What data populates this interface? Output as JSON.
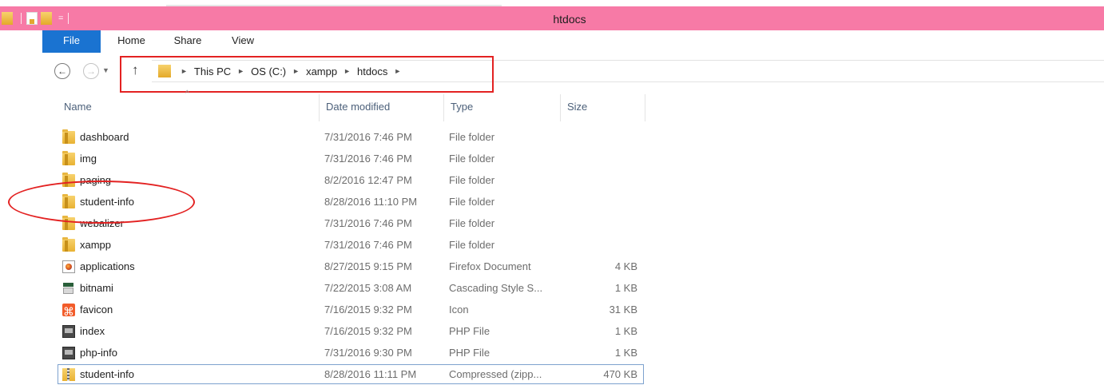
{
  "window": {
    "title": "htdocs",
    "accent_color": "#f77aa6"
  },
  "quick_access": {
    "icons": [
      "folder-icon",
      "properties-icon",
      "new-folder-icon"
    ],
    "dropdown_glyph": "="
  },
  "ribbon": {
    "tabs": [
      {
        "id": "file",
        "label": "File"
      },
      {
        "id": "home",
        "label": "Home"
      },
      {
        "id": "share",
        "label": "Share"
      },
      {
        "id": "view",
        "label": "View"
      }
    ]
  },
  "navigation": {
    "back_icon": "back-arrow-icon",
    "forward_icon": "forward-arrow-icon",
    "up_icon": "up-arrow-icon",
    "breadcrumb": [
      "This PC",
      "OS (C:)",
      "xampp",
      "htdocs"
    ]
  },
  "columns": {
    "name": "Name",
    "date_modified": "Date modified",
    "type": "Type",
    "size": "Size"
  },
  "files": [
    {
      "name": "dashboard",
      "date": "7/31/2016 7:46 PM",
      "type": "File folder",
      "size": "",
      "icon": "folder-icon"
    },
    {
      "name": "img",
      "date": "7/31/2016 7:46 PM",
      "type": "File folder",
      "size": "",
      "icon": "folder-icon"
    },
    {
      "name": "paging",
      "date": "8/2/2016 12:47 PM",
      "type": "File folder",
      "size": "",
      "icon": "folder-icon"
    },
    {
      "name": "student-info",
      "date": "8/28/2016 11:10 PM",
      "type": "File folder",
      "size": "",
      "icon": "folder-icon"
    },
    {
      "name": "webalizer",
      "date": "7/31/2016 7:46 PM",
      "type": "File folder",
      "size": "",
      "icon": "folder-icon"
    },
    {
      "name": "xampp",
      "date": "7/31/2016 7:46 PM",
      "type": "File folder",
      "size": "",
      "icon": "folder-icon"
    },
    {
      "name": "applications",
      "date": "8/27/2015 9:15 PM",
      "type": "Firefox Document",
      "size": "4 KB",
      "icon": "firefox-document-icon"
    },
    {
      "name": "bitnami",
      "date": "7/22/2015 3:08 AM",
      "type": "Cascading Style S...",
      "size": "1 KB",
      "icon": "css-file-icon"
    },
    {
      "name": "favicon",
      "date": "7/16/2015 9:32 PM",
      "type": "Icon",
      "size": "31 KB",
      "icon": "xampp-icon"
    },
    {
      "name": "index",
      "date": "7/16/2015 9:32 PM",
      "type": "PHP File",
      "size": "1 KB",
      "icon": "php-file-icon"
    },
    {
      "name": "php-info",
      "date": "7/31/2016 9:30 PM",
      "type": "PHP File",
      "size": "1 KB",
      "icon": "php-file-icon"
    },
    {
      "name": "student-info",
      "date": "8/28/2016 11:11 PM",
      "type": "Compressed (zipp...",
      "size": "470 KB",
      "icon": "zip-folder-icon"
    }
  ]
}
